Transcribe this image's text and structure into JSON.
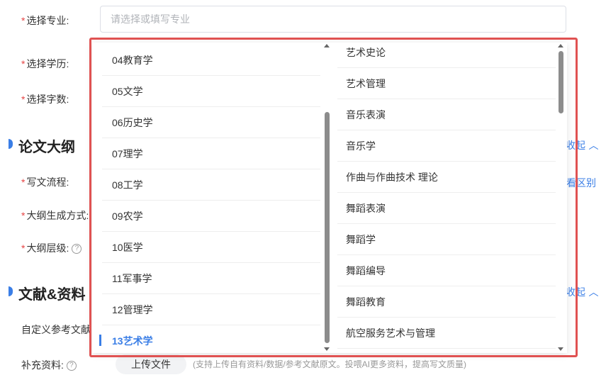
{
  "form": {
    "major_label": "选择专业:",
    "major_placeholder": "请选择或填写专业",
    "degree_label": "选择学历:",
    "wordcount_label": "选择字数:",
    "outline_section_title": "论文大纲",
    "process_label": "写文流程:",
    "outline_method_label": "大纲生成方式:",
    "outline_level_label": "大纲层级:",
    "refs_section_title": "文献&资料",
    "custom_refs_label": "自定义参考文献（",
    "supplement_label": "补充资料:",
    "upload_button": "上传文件",
    "upload_hint": "(支持上传自有资料/数据/参考文献原文。投喂AI更多资料，提高写文质量)",
    "collapse_text_1": "收起",
    "diff_link": "看区别",
    "collapse_text_2": "收起",
    "required_mark": "*",
    "help_glyph": "?"
  },
  "dropdown": {
    "categories": [
      {
        "label": "04教育学",
        "active": false
      },
      {
        "label": "05文学",
        "active": false
      },
      {
        "label": "06历史学",
        "active": false
      },
      {
        "label": "07理学",
        "active": false
      },
      {
        "label": "08工学",
        "active": false
      },
      {
        "label": "09农学",
        "active": false
      },
      {
        "label": "10医学",
        "active": false
      },
      {
        "label": "11军事学",
        "active": false
      },
      {
        "label": "12管理学",
        "active": false
      },
      {
        "label": "13艺术学",
        "active": true
      }
    ],
    "subjects": [
      "艺术史论",
      "艺术管理",
      "音乐表演",
      "音乐学",
      "作曲与作曲技术 理论",
      "舞蹈表演",
      "舞蹈学",
      "舞蹈编导",
      "舞蹈教育",
      "航空服务艺术与管理"
    ]
  },
  "colors": {
    "accent": "#3a7ee6",
    "required": "#e64545",
    "highlight_frame": "#e05252"
  }
}
